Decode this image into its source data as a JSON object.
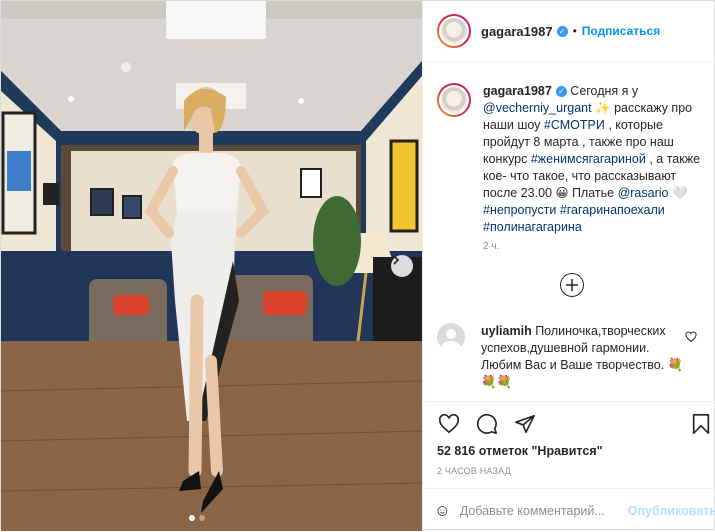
{
  "post": {
    "username": "gagara1987",
    "verified_icon": "verified-badge-icon",
    "separator": "•",
    "follow_label": "Подписаться",
    "caption": {
      "username": "gagara1987",
      "t1": " Сегодня я у ",
      "mention1": "@vecherniy_urgant",
      "t2": " ✨ расскажу про наши шоу ",
      "tag1": "#СМОТРИ",
      "t3": " , которые пройдут 8 марта , также про наш конкурс ",
      "tag2": "#женимсягагариной",
      "t4": " , а также кое- что такое, что рассказывают после 23.00 😀 Платье ",
      "mention2": "@rasario",
      "t5": " 🤍 ",
      "tag3": "#непропусти",
      "t6": " ",
      "tag4": "#гагаринапоехали",
      "t7": " ",
      "tag5": "#полинагагарина"
    },
    "caption_time": "2 ч.",
    "comment": {
      "username": "uyliamih",
      "text": " Полиночка,творческих успехов,душевной гармонии. Любим Вас и Ваше творчество. 💐💐💐"
    },
    "likes": "52 816 отметок \"Нравится\"",
    "posted_ago": "2 ЧАСОВ НАЗАД",
    "add_comment": {
      "emoji_icon": "smiley-icon",
      "placeholder": "Добавьте комментарий...",
      "publish_label": "Опубликовать"
    },
    "carousel": {
      "count": 2,
      "active": 0
    }
  },
  "colors": {
    "accent": "#0095f6",
    "publish_disabled": "#b2dffc",
    "link": "#00376b",
    "muted": "#8e8e8e"
  }
}
